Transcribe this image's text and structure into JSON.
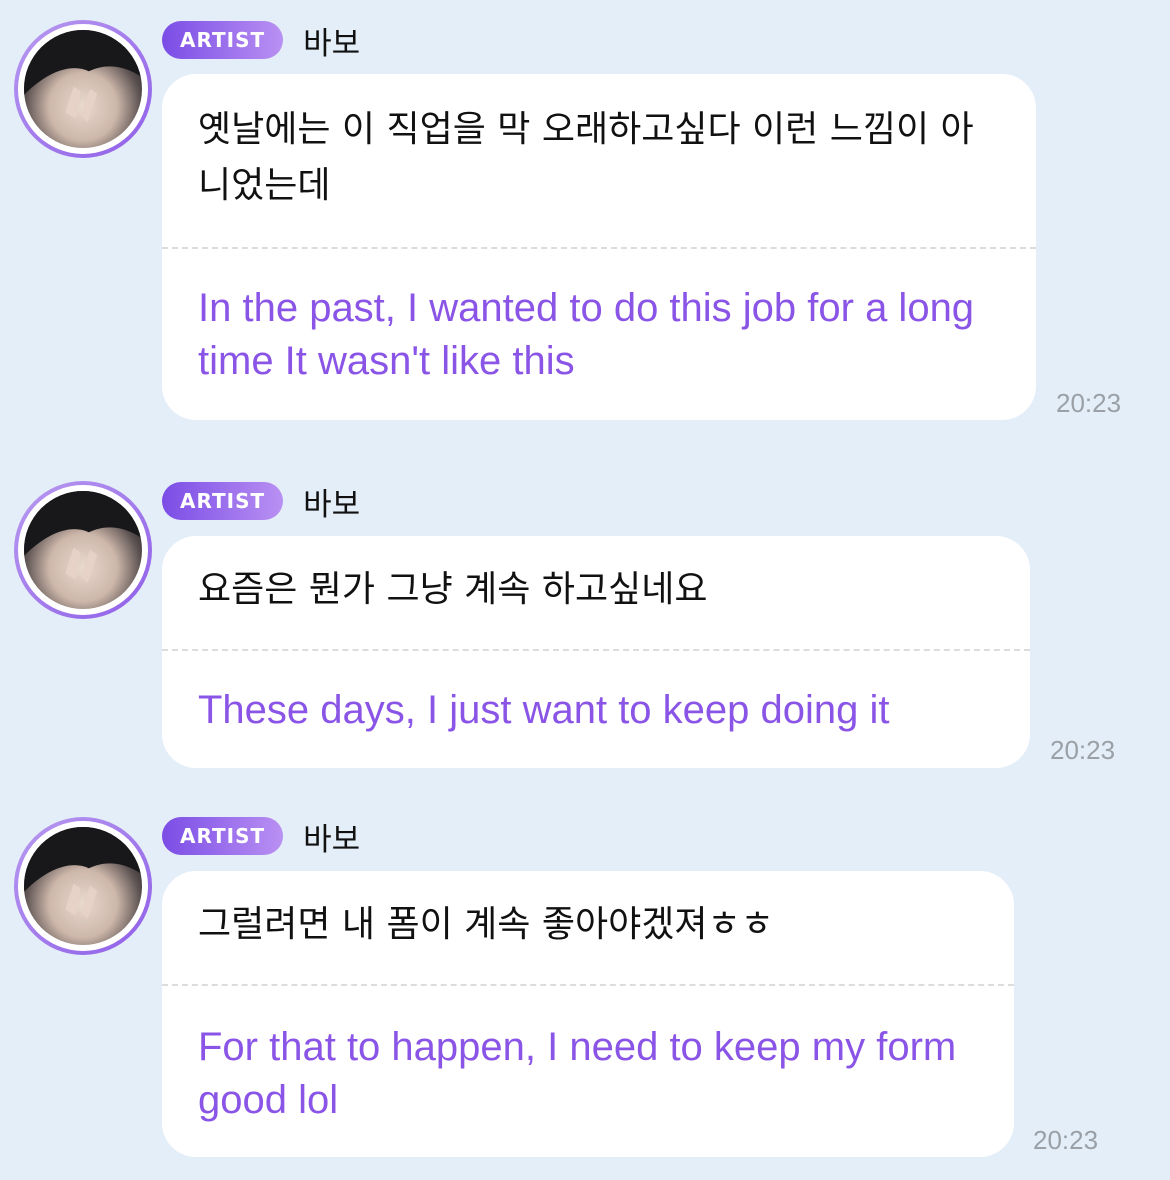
{
  "messages": [
    {
      "badge": "ARTIST",
      "sender": "바보",
      "original": "옛날에는 이 직업을 막 오래하고싶다 이런 느낌이 아니었는데",
      "translation": "In the past, I wanted to do this job for a long time It wasn't like this",
      "time": "20:23"
    },
    {
      "badge": "ARTIST",
      "sender": "바보",
      "original": "요즘은 뭔가 그냥 계속 하고싶네요",
      "translation": "These days, I just want to keep doing it",
      "time": "20:23"
    },
    {
      "badge": "ARTIST",
      "sender": "바보",
      "original": "그럴려면 내 폼이 계속 좋아야겠져ㅎㅎ",
      "translation": "For that to happen, I need to keep my form good lol",
      "time": "20:23"
    }
  ],
  "colors": {
    "background": "#e4eef8",
    "bubble": "#ffffff",
    "translation_text": "#8a55e6",
    "badge_start": "#7b4de6",
    "badge_end": "#b990f2",
    "timestamp": "#9aa0a6"
  },
  "icons": {
    "avatar": "profile-photo"
  }
}
